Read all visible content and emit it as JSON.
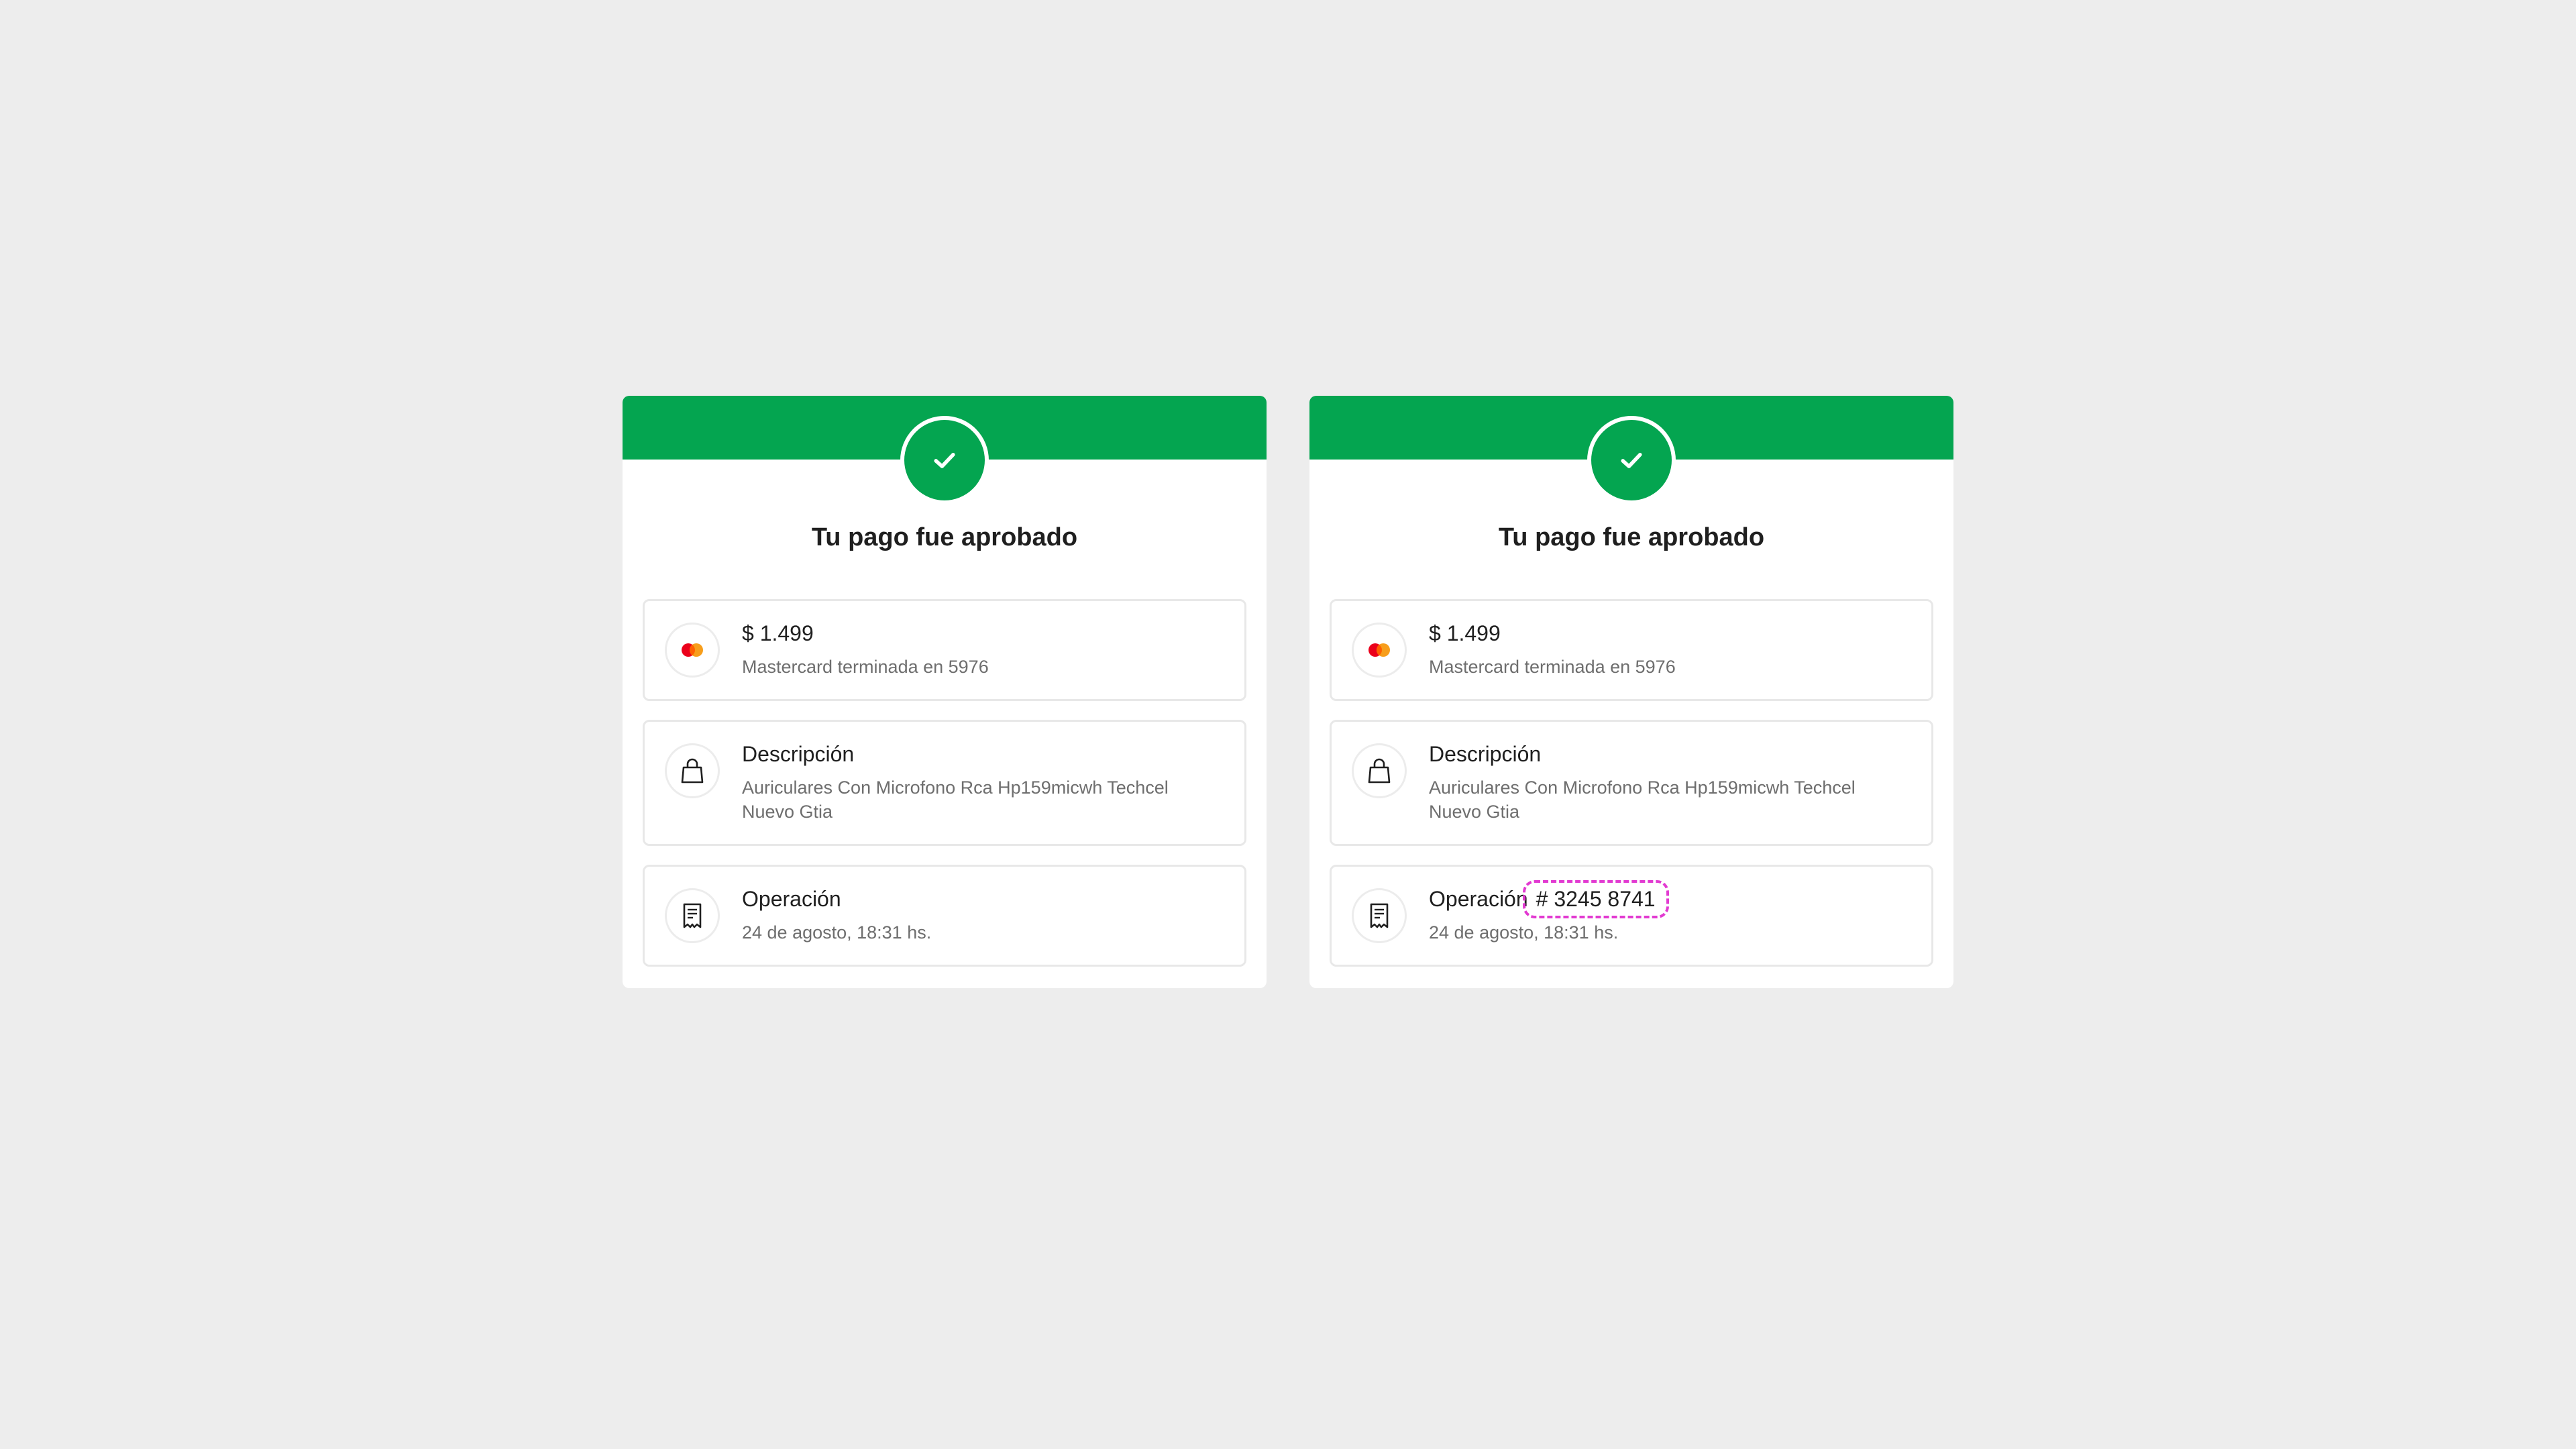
{
  "cards": [
    {
      "title": "Tu pago fue aprobado",
      "payment": {
        "amount": "$ 1.499",
        "card": "Mastercard terminada en 5976"
      },
      "description": {
        "label": "Descripción",
        "text": "Auriculares Con Microfono Rca Hp159micwh Techcel Nuevo Gtia"
      },
      "operation": {
        "label": "Operación",
        "date": "24 de agosto, 18:31 hs."
      }
    },
    {
      "title": "Tu pago fue aprobado",
      "payment": {
        "amount": "$ 1.499",
        "card": "Mastercard terminada en 5976"
      },
      "description": {
        "label": "Descripción",
        "text": "Auriculares Con Microfono Rca Hp159micwh Techcel Nuevo Gtia"
      },
      "operation": {
        "label": "Operación",
        "number": "# 3245 8741",
        "date": "24 de agosto, 18:31 hs."
      }
    }
  ],
  "colors": {
    "background": "#ededed",
    "success_green": "#04a550",
    "highlight_magenta": "#e23ad1",
    "mastercard_red": "#eb001b",
    "mastercard_orange": "#f79e1b"
  },
  "icons": {
    "status": "check-icon",
    "payment": "mastercard-icon",
    "description": "shopping-bag-icon",
    "operation": "receipt-icon"
  }
}
